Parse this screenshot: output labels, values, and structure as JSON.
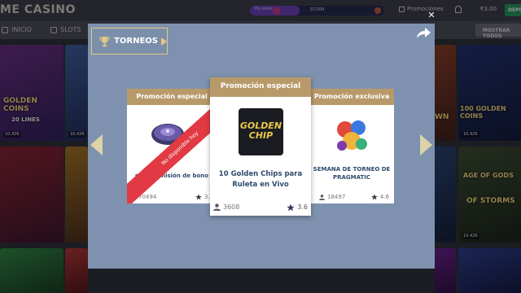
{
  "header": {
    "logo_text": "ME CASINO",
    "level": {
      "label": "My level",
      "progress_text": "37/100",
      "progress_fraction": 0.37
    },
    "promotions_label": "Promociones",
    "balance": "€3.00",
    "deposit_label": "DEPO"
  },
  "nav": {
    "items": [
      "INICIO",
      "SLOTS"
    ],
    "show_all_label": "MOSTRAR TODOS"
  },
  "tiles": [
    {
      "label": "GOLDEN COINS",
      "sub": "20 LINES",
      "meta": "10,426"
    },
    {
      "label": "",
      "sub": "",
      "meta": "10,426"
    },
    {
      "label": "WN",
      "sub": "",
      "meta": ""
    },
    {
      "label": "100 GOLDEN COINS",
      "sub": "",
      "meta": "10,426"
    },
    {
      "label": "AGE OF GODS",
      "sub": "OF STORMS",
      "meta": "10,426"
    }
  ],
  "modal": {
    "section_title": "TORNEOS",
    "cards": [
      {
        "header": "Promoción especial",
        "title": "para la misión de bono",
        "players": "70494",
        "rating": "3.9",
        "ribbon": "No disponible hoy"
      },
      {
        "header": "Promoción especial",
        "title": "10 Golden Chips para Ruleta en Vivo",
        "players": "3608",
        "rating": "3.6",
        "logo_line1": "GOLDEN",
        "logo_line2": "CHIP"
      },
      {
        "header": "Promoción exclusiva",
        "title": "SEMANA DE TORNEO DE PRAGMATIC",
        "players": "18497",
        "rating": "4.6"
      }
    ]
  },
  "colors": {
    "modal_bg": "#7e92b0",
    "card_header": "#b89a6a",
    "ribbon": "#e23a44",
    "gold_accent": "#e2c886",
    "title_text": "#2f4a6e"
  }
}
